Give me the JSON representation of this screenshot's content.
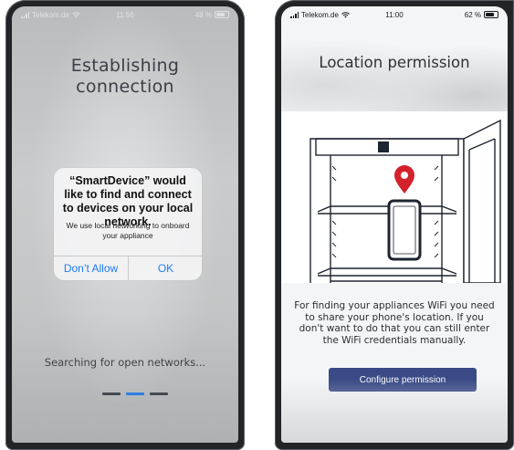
{
  "left_screen": {
    "status": {
      "carrier": "Telekom.de",
      "time": "11:56",
      "battery": "48 %"
    },
    "title_line1": "Establishing",
    "title_line2": "connection",
    "alert": {
      "title": "“SmartDevice” would like to find and connect to devices on your local network.",
      "message": "We use local networking to onboard your appliance",
      "buttons": {
        "dont_allow": "Don’t Allow",
        "ok": "OK"
      }
    },
    "searching": "Searching for open networks...",
    "progress": {
      "total": 3,
      "active_index": 1
    }
  },
  "right_screen": {
    "status": {
      "carrier": "Telekom.de",
      "time": "11:00",
      "battery": "62 %"
    },
    "title": "Location permission",
    "description": "For finding your appliances WiFi you need to share your phone's location. If you don't want to do that you can still enter the WiFi credentials manually.",
    "button_label": "Configure permission"
  },
  "colors": {
    "accent_blue": "#1f7bf2",
    "progress_active": "#2f7fe0",
    "button_bg": "#3a4a86",
    "pin_red": "#d4202a",
    "phone_frame": "#222528"
  }
}
